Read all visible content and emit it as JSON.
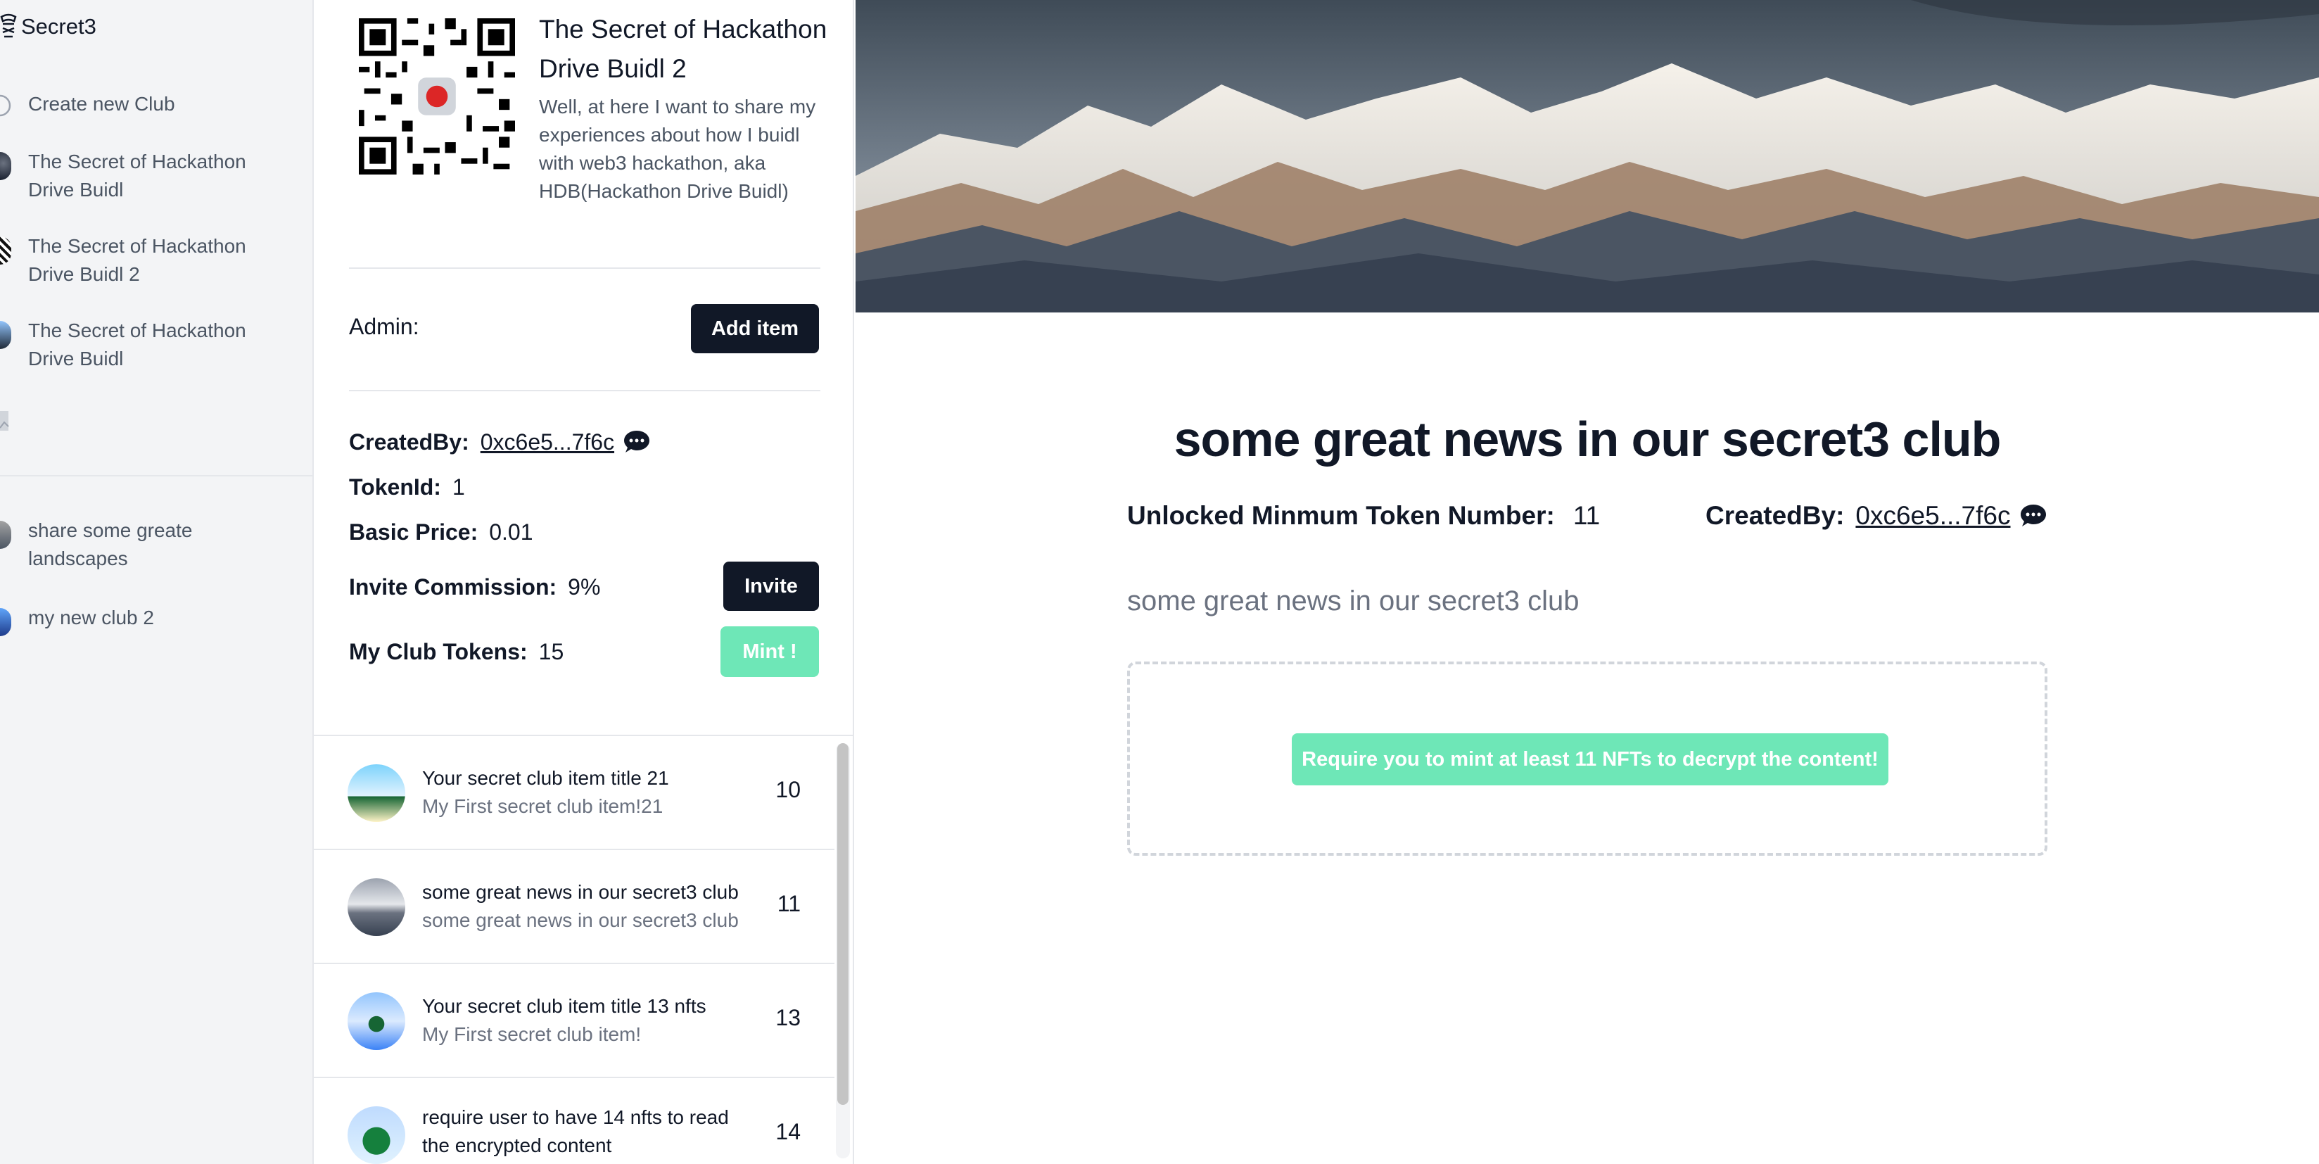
{
  "app": {
    "name": "Secret3"
  },
  "sidebar": {
    "create_label": "Create new Club",
    "clubs": [
      {
        "label": "The Secret of Hackathon Drive Buidl"
      },
      {
        "label": "The Secret of Hackathon Drive Buidl 2"
      },
      {
        "label": "The Secret of Hackathon Drive Buidl"
      }
    ],
    "joined": [
      {
        "label": "share some greate landscapes"
      },
      {
        "label": "my new club 2"
      }
    ]
  },
  "club": {
    "title": "The Secret of Hackathon Drive Buidl 2",
    "description": "Well, at here I want to share my experiences about how I buidl with web3 hackathon, aka HDB(Hackathon Drive Buidl)",
    "admin_label": "Admin:",
    "add_item_label": "Add item",
    "created_by_key": "CreatedBy:",
    "created_by_value": "0xc6e5...7f6c",
    "token_id_key": "TokenId:",
    "token_id_value": "1",
    "basic_price_key": "Basic Price:",
    "basic_price_value": "0.01",
    "invite_commission_key": "Invite Commission:",
    "invite_commission_value": "9%",
    "invite_label": "Invite",
    "my_tokens_key": "My Club Tokens:",
    "my_tokens_value": "15",
    "mint_label": "Mint !"
  },
  "items": [
    {
      "title": "Your secret club item title 21",
      "subtitle": "My First secret club item!21",
      "count": "10"
    },
    {
      "title": "some great news in our secret3 club",
      "subtitle": "some great news in our secret3 club",
      "count": "11"
    },
    {
      "title": "Your secret club item title 13 nfts",
      "subtitle": "My First secret club item!",
      "count": "13"
    },
    {
      "title": "require user to have 14 nfts to read the encrypted content",
      "subtitle": "",
      "count": "14"
    }
  ],
  "detail": {
    "title": "some great news in our secret3 club",
    "unlock_key": "Unlocked Minmum Token Number:",
    "unlock_value": "11",
    "created_by_key": "CreatedBy:",
    "created_by_value": "0xc6e5...7f6c",
    "description": "some great news in our secret3 club",
    "decrypt_label": "Require you to mint at least 11 NFTs to decrypt the content!"
  },
  "colors": {
    "dark": "#111827",
    "mint": "#6ee7b7",
    "muted": "#6b7280",
    "sidebar_bg": "#f3f4f6"
  },
  "icons": [
    "secret3-logo-icon",
    "plus-circle-icon",
    "chat-bubble-icon",
    "qr-code-icon"
  ]
}
